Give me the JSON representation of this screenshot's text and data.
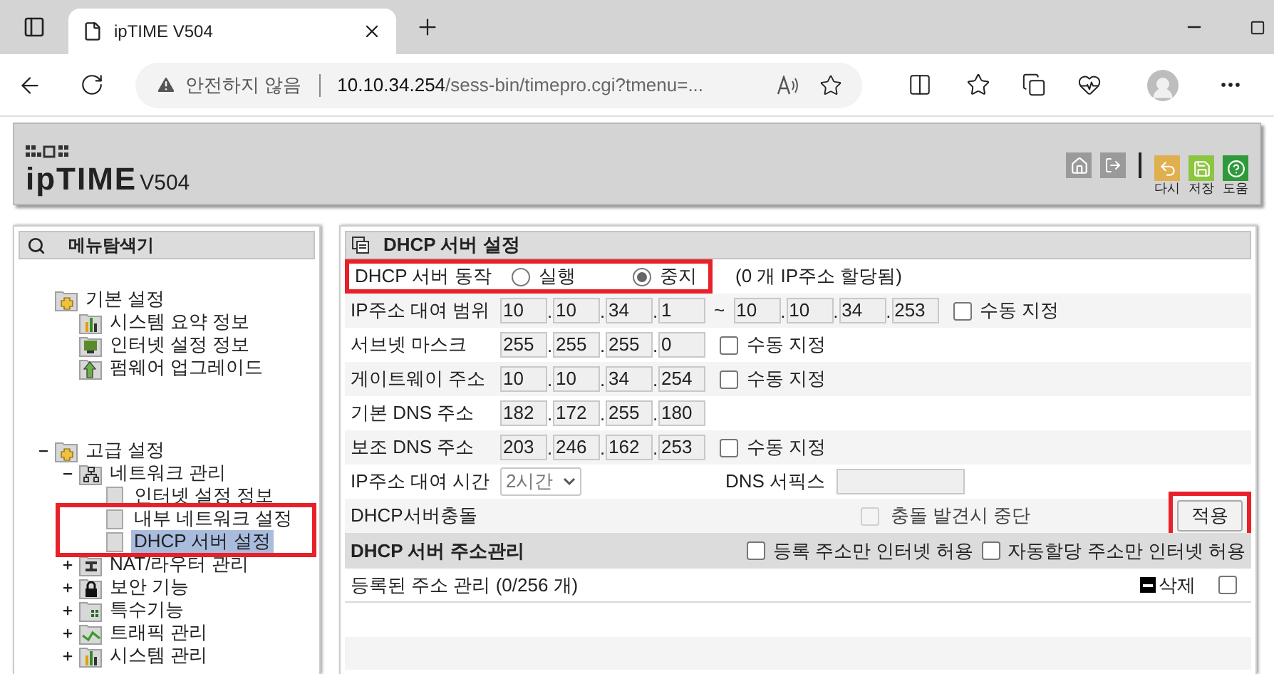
{
  "browser": {
    "tab_title": "ipTIME V504",
    "security": "안전하지 않음",
    "address_host": "10.10.34.254",
    "address_path": "/sess-bin/timepro.cgi?tmenu=..."
  },
  "header": {
    "logo": "ipTIME",
    "model": "V504",
    "actions": [
      {
        "label": "다시",
        "color": "#e0b050"
      },
      {
        "label": "저장",
        "color": "#8cc63f"
      },
      {
        "label": "도움",
        "color": "#2e9a3a"
      }
    ]
  },
  "sidebar": {
    "title": "메뉴탐색기",
    "tree": [
      {
        "label": "기본 설정",
        "kind": "folder",
        "selected": false,
        "children": [
          {
            "label": "시스템 요약 정보",
            "kind": "chart",
            "selected": false
          },
          {
            "label": "인터넷 설정 정보",
            "kind": "monitor",
            "selected": false
          },
          {
            "label": "펌웨어 업그레이드",
            "kind": "upload",
            "selected": false
          }
        ]
      },
      {
        "label": "고급 설정",
        "kind": "folder",
        "selected": false,
        "expanded": true,
        "children": [
          {
            "label": "네트워크 관리",
            "kind": "network",
            "selected": false,
            "expanded": true,
            "children": [
              {
                "label": "인터넷 설정 정보",
                "kind": "page",
                "selected": false,
                "highlighted": false
              },
              {
                "label": "내부 네트워크 설정",
                "kind": "page",
                "selected": false,
                "highlighted": true
              },
              {
                "label": "DHCP 서버 설정",
                "kind": "page",
                "selected": true,
                "highlighted": true
              }
            ]
          },
          {
            "label": "NAT/라우터 관리",
            "kind": "router",
            "selected": false,
            "expanded": false
          },
          {
            "label": "보안 기능",
            "kind": "lock",
            "selected": false,
            "expanded": false
          },
          {
            "label": "특수기능",
            "kind": "grid",
            "selected": false,
            "expanded": false
          },
          {
            "label": "트래픽 관리",
            "kind": "traffic",
            "selected": false,
            "expanded": false
          },
          {
            "label": "시스템 관리",
            "kind": "chart",
            "selected": false,
            "expanded": false
          }
        ]
      }
    ]
  },
  "main": {
    "title": "DHCP 서버 설정",
    "server_mode": {
      "label": "DHCP 서버 동작",
      "highlighted": true,
      "options": [
        {
          "label": "실행",
          "selected": false
        },
        {
          "label": "중지",
          "selected": true
        }
      ],
      "note": "(0 개 IP주소 할당됨)"
    },
    "rows": [
      {
        "kind": "range",
        "label": "IP주소 대여 범위",
        "separator": ".",
        "octets": [
          "10",
          "10",
          "34",
          "1"
        ],
        "range_mark": "~",
        "end_octets": [
          "10",
          "10",
          "34",
          "253"
        ],
        "manual": {
          "label": "수동 지정",
          "checked": false
        }
      },
      {
        "kind": "ip",
        "label": "서브넷 마스크",
        "separator": ".",
        "octets": [
          "255",
          "255",
          "255",
          "0"
        ],
        "manual": {
          "label": "수동 지정",
          "checked": false
        }
      },
      {
        "kind": "ip",
        "label": "게이트웨이 주소",
        "separator": ".",
        "octets": [
          "10",
          "10",
          "34",
          "254"
        ],
        "manual": {
          "label": "수동 지정",
          "checked": false
        }
      },
      {
        "kind": "ip",
        "label": "기본 DNS 주소",
        "separator": ".",
        "octets": [
          "182",
          "172",
          "255",
          "180"
        ]
      },
      {
        "kind": "ip",
        "label": "보조 DNS 주소",
        "separator": ".",
        "octets": [
          "203",
          "246",
          "162",
          "253"
        ],
        "manual": {
          "label": "수동 지정",
          "checked": false
        }
      }
    ],
    "lease": {
      "label": "IP주소 대여 시간",
      "value": "2시간",
      "dns_suffix_label": "DNS 서픽스"
    },
    "conflict": {
      "label": "DHCP서버충돌",
      "option": {
        "label": "충돌 발견시 중단",
        "checked": false,
        "disabled": true
      },
      "apply": "적용",
      "apply_highlighted": true
    },
    "address_mgmt": {
      "title": "DHCP 서버 주소관리",
      "options": [
        {
          "label": "등록 주소만 인터넷 허용",
          "checked": false
        },
        {
          "label": "자동할당 주소만 인터넷 허용",
          "checked": false
        }
      ],
      "registered": "등록된 주소 관리 (0/256 개)",
      "delete": "삭제",
      "select_all_checked": false
    }
  }
}
